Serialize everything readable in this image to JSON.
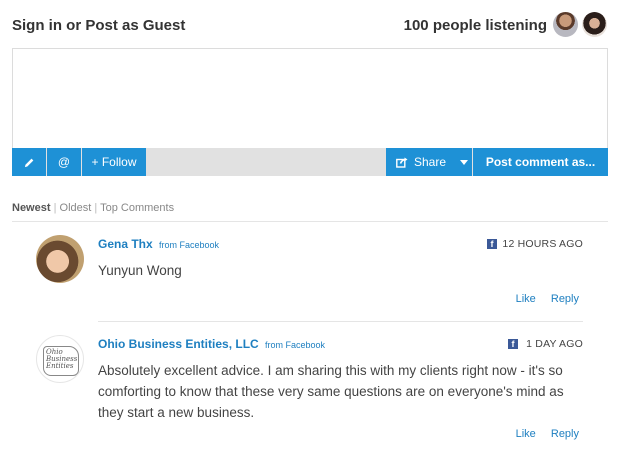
{
  "header": {
    "signin_text": "Sign in or Post as Guest",
    "listening_text": "100 people listening"
  },
  "toolbar": {
    "pencil_icon": "pencil-icon",
    "at_label": "@",
    "follow_label": "+ Follow",
    "share_label": "Share",
    "post_label": "Post comment as..."
  },
  "sort": {
    "newest": "Newest",
    "oldest": "Oldest",
    "top": "Top Comments",
    "separator": "|"
  },
  "comments": [
    {
      "author": "Gena Thx",
      "source": "from Facebook",
      "time": "12 HOURS AGO",
      "text": "Yunyun Wong",
      "like": "Like",
      "reply": "Reply"
    },
    {
      "author": "Ohio Business Entities, LLC",
      "source": "from Facebook",
      "time": "1 DAY AGO",
      "text": "Absolutely excellent advice. I am sharing this with my clients right now - it's so comforting to know that these very same questions are on everyone's mind as they start a new business.",
      "like": "Like",
      "reply": "Reply",
      "logo_text": "Ohio Business Entities"
    }
  ],
  "colors": {
    "accent": "#1e91d6",
    "link": "#1e7fc0",
    "facebook": "#3b5998"
  }
}
